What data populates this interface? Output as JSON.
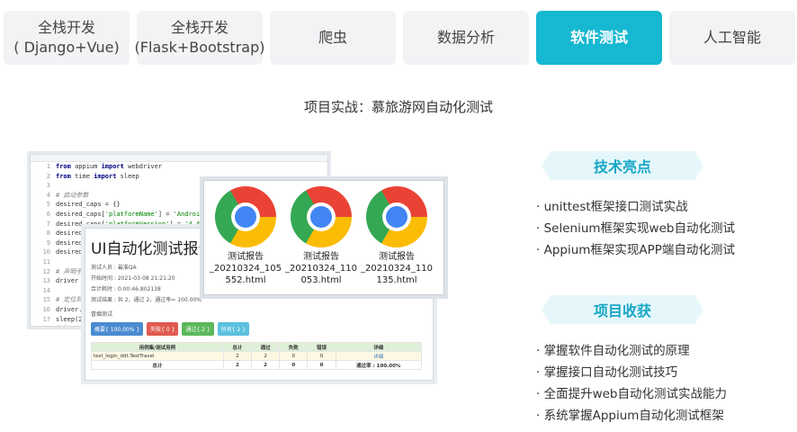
{
  "tabs": [
    {
      "line1": "全栈开发",
      "line2": "( Django+Vue)",
      "active": false
    },
    {
      "line1": "全栈开发",
      "line2": "(Flask+Bootstrap)",
      "active": false
    },
    {
      "line1": "爬虫",
      "line2": "",
      "active": false
    },
    {
      "line1": "数据分析",
      "line2": "",
      "active": false
    },
    {
      "line1": "软件测试",
      "line2": "",
      "active": true
    },
    {
      "line1": "人工智能",
      "line2": "",
      "active": false
    }
  ],
  "subtitle": "项目实战：慕旅游网自动化测试",
  "code_lines": [
    {
      "n": "1",
      "t": "from appium import webdriver"
    },
    {
      "n": "2",
      "t": "from time import sleep"
    },
    {
      "n": "3",
      "t": ""
    },
    {
      "n": "4",
      "t": "# 启动参数"
    },
    {
      "n": "5",
      "t": "desired_caps = {}"
    },
    {
      "n": "6",
      "t": "desired_caps['platformName'] = 'Android'"
    },
    {
      "n": "7",
      "t": "desired_caps['platformVersion'] = '4.4.2'"
    },
    {
      "n": "8",
      "t": "desired_caps['deviceName'] = '127.0.0.1:6200"
    },
    {
      "n": "9",
      "t": "desired_c"
    },
    {
      "n": "10",
      "t": "desired_c"
    },
    {
      "n": "11",
      "t": ""
    },
    {
      "n": "12",
      "t": "# 声明手机"
    },
    {
      "n": "13",
      "t": "driver = "
    },
    {
      "n": "14",
      "t": ""
    },
    {
      "n": "15",
      "t": "# 定位到搜"
    },
    {
      "n": "16",
      "t": "driver.fi"
    },
    {
      "n": "17",
      "t": "sleep(2)"
    },
    {
      "n": "18",
      "t": "driver.qu"
    }
  ],
  "report": {
    "title": "UI自动化测试报告",
    "tester": "测试人员 : 最准QA",
    "start": "开始时间 : 2021-03-08 21:21:20",
    "duration": "合计耗时 : 0:00:46.802138",
    "result": "测试结果 : 共 2，通过 2，通过率= 100.00%",
    "scenario": "冒烟测试",
    "pills": [
      {
        "label": "概要{ 100.00% }",
        "color": "#4a8bd1"
      },
      {
        "label": "失败{ 0 }",
        "color": "#e05a4f"
      },
      {
        "label": "通过{ 2 }",
        "color": "#5cb85c"
      },
      {
        "label": "所有{ 2 }",
        "color": "#5bc0de"
      }
    ],
    "table": {
      "header": [
        "用例集/测试用例",
        "总计",
        "通过",
        "失败",
        "错误",
        "详细"
      ],
      "row": [
        "test_login_ddt.TestTravel",
        "2",
        "2",
        "0",
        "0",
        "详细"
      ],
      "total": [
        "总计",
        "2",
        "2",
        "0",
        "0",
        "通过率 : 100.00%"
      ]
    }
  },
  "files": [
    {
      "line1": "测试报告",
      "line2": "_20210324_105",
      "line3": "552.html"
    },
    {
      "line1": "测试报告",
      "line2": "_20210324_110",
      "line3": "053.html"
    },
    {
      "line1": "测试报告",
      "line2": "_20210324_110",
      "line3": "135.html"
    }
  ],
  "highlights": {
    "title": "技术亮点",
    "items": [
      "· unittest框架接口测试实战",
      "· Selenium框架实现web自动化测试",
      "· Appium框架实现APP端自动化测试"
    ]
  },
  "gains": {
    "title": "项目收获",
    "items": [
      "· 掌握软件自动化测试的原理",
      "· 掌握接口自动化测试技巧",
      "· 全面提升web自动化测试实战能力",
      "· 系统掌握Appium自动化测试框架"
    ]
  }
}
